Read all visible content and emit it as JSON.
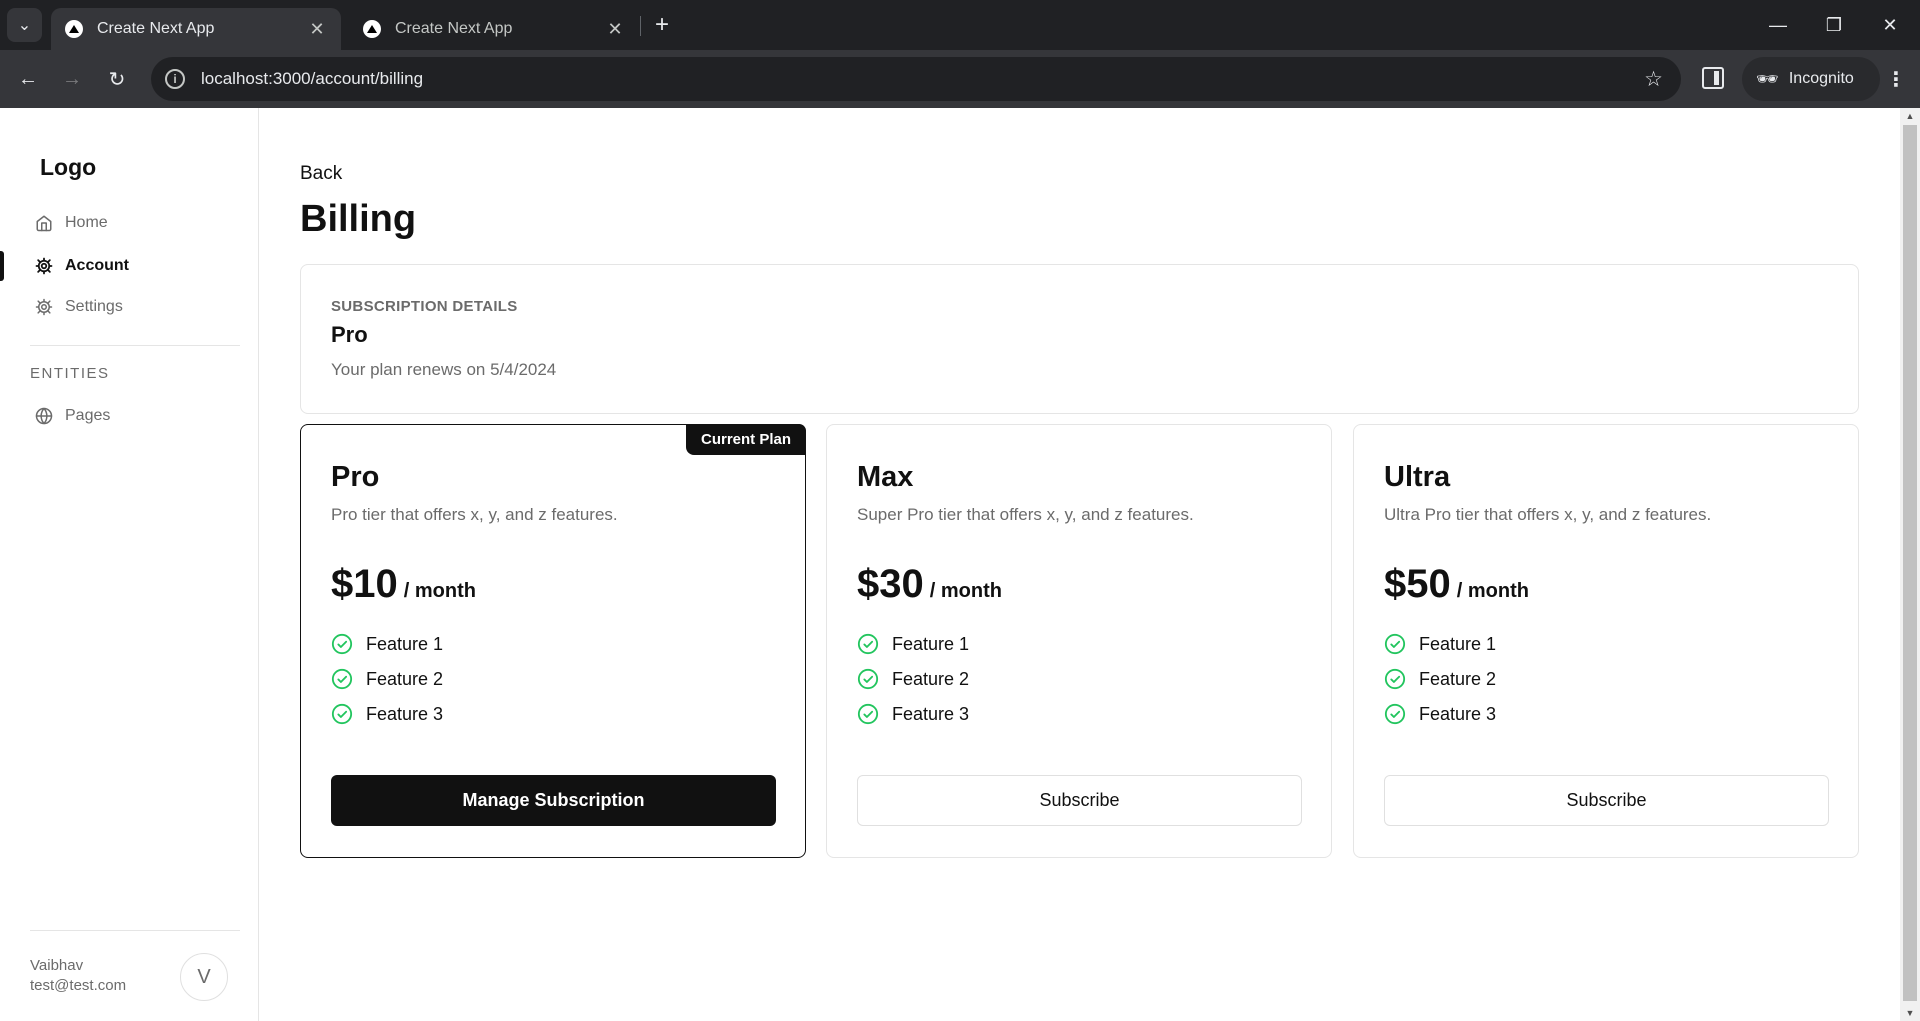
{
  "browser": {
    "tabs": [
      {
        "title": "Create Next App",
        "active": true
      },
      {
        "title": "Create Next App",
        "active": false
      }
    ],
    "url": "localhost:3000/account/billing",
    "profile_label": "Incognito"
  },
  "sidebar": {
    "logo": "Logo",
    "nav": [
      {
        "label": "Home",
        "icon": "home-icon"
      },
      {
        "label": "Account",
        "icon": "gear-icon",
        "active": true
      },
      {
        "label": "Settings",
        "icon": "gear-icon"
      }
    ],
    "section_label": "ENTITIES",
    "entities": [
      {
        "label": "Pages",
        "icon": "globe-icon"
      }
    ],
    "user": {
      "name": "Vaibhav",
      "email": "test@test.com",
      "avatar_initial": "V"
    }
  },
  "main": {
    "back_label": "Back",
    "title": "Billing",
    "subscription": {
      "eyebrow": "SUBSCRIPTION DETAILS",
      "plan": "Pro",
      "renewal": "Your plan renews on 5/4/2024"
    },
    "plans": [
      {
        "name": "Pro",
        "description": "Pro tier that offers x, y, and z features.",
        "price": "$10",
        "period": "/ month",
        "features": [
          "Feature 1",
          "Feature 2",
          "Feature 3"
        ],
        "button": "Manage Subscription",
        "badge": "Current Plan"
      },
      {
        "name": "Max",
        "description": "Super Pro tier that offers x, y, and z features.",
        "price": "$30",
        "period": "/ month",
        "features": [
          "Feature 1",
          "Feature 2",
          "Feature 3"
        ],
        "button": "Subscribe"
      },
      {
        "name": "Ultra",
        "description": "Ultra Pro tier that offers x, y, and z features.",
        "price": "$50",
        "period": "/ month",
        "features": [
          "Feature 1",
          "Feature 2",
          "Feature 3"
        ],
        "button": "Subscribe"
      }
    ]
  },
  "colors": {
    "accent": "#111111",
    "check_green": "#22c55e",
    "muted_text": "#6b6b6b",
    "border": "#e5e5e5"
  }
}
